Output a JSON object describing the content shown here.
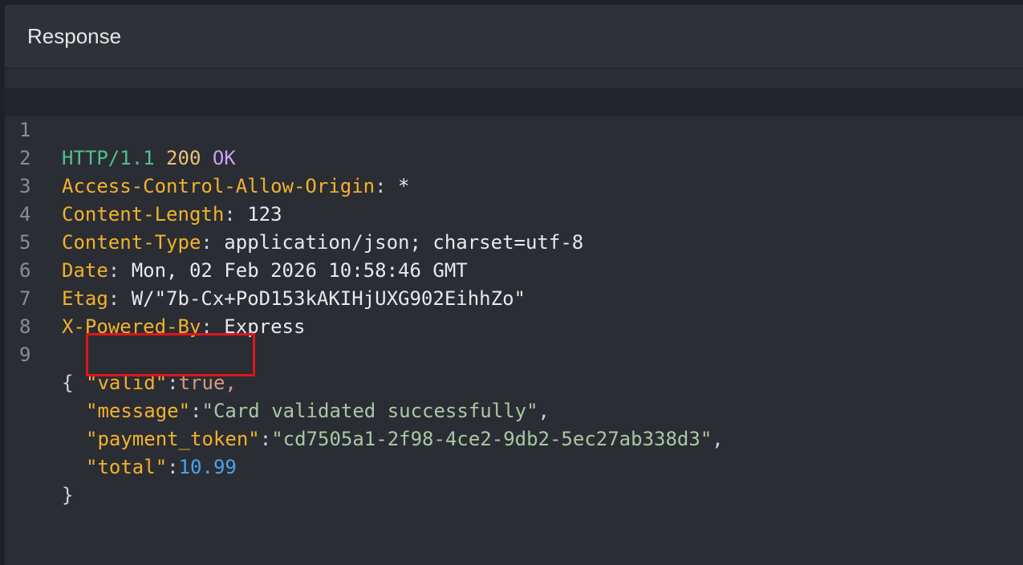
{
  "panel": {
    "title": "Response"
  },
  "line_numbers": [
    "1",
    "2",
    "3",
    "4",
    "5",
    "6",
    "7",
    "8",
    "9"
  ],
  "status_line": {
    "protocol": "HTTP/1.1",
    "code": "200",
    "text": "OK"
  },
  "headers": [
    {
      "name": "Access-Control-Allow-Origin",
      "value": "*"
    },
    {
      "name": "Content-Length",
      "value": "123"
    },
    {
      "name": "Content-Type",
      "value": "application/json; charset=utf-8"
    },
    {
      "name": "Date",
      "value": "Mon, 02 Feb 2026 10:58:46 GMT"
    },
    {
      "name": "Etag",
      "value": "W/\"7b-Cx+PoD153kAKIHjUXG902EihhZo\""
    },
    {
      "name": "X-Powered-By",
      "value": "Express"
    }
  ],
  "body": {
    "open_brace": "{",
    "close_brace": "}",
    "fields": [
      {
        "key": "\"valid\"",
        "value": "true"
      },
      {
        "key": "\"message\"",
        "value": "\"Card validated successfully\""
      },
      {
        "key": "\"payment_token\"",
        "value": "\"cd7505a1-2f98-4ce2-9db2-5ec27ab338d3\""
      },
      {
        "key": "\"total\"",
        "value": "10.99"
      }
    ]
  },
  "colors": {
    "highlight_box": "#e0151c",
    "json_key": "#f2b22a",
    "string_value": "#a8c8a4",
    "number_value": "#4aa3ea",
    "boolean_value": "#d49a86"
  }
}
